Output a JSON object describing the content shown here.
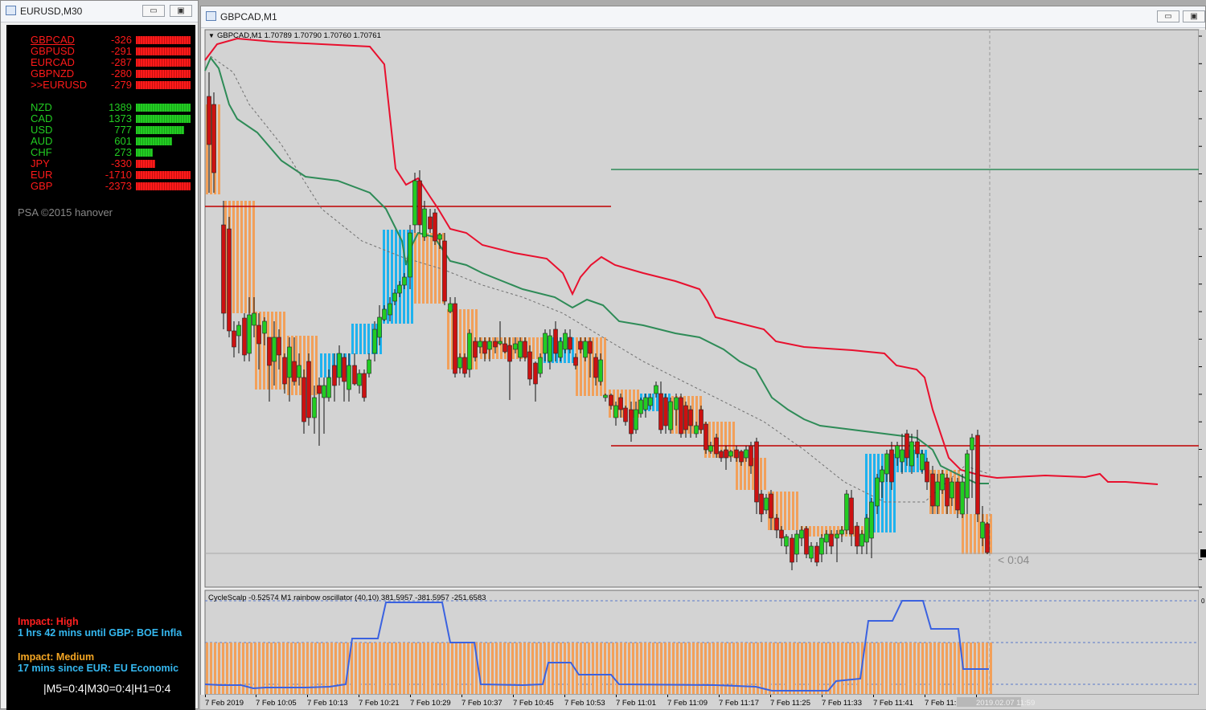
{
  "left_window": {
    "title": "EURUSD,M30",
    "pairs": [
      {
        "name": "GBPCAD",
        "value": "-326",
        "strength": 1.0,
        "underline": true
      },
      {
        "name": "GBPUSD",
        "value": "-291",
        "strength": 1.0
      },
      {
        "name": "EURCAD",
        "value": "-287",
        "strength": 1.0
      },
      {
        "name": "GBPNZD",
        "value": "-280",
        "strength": 1.0
      },
      {
        "name": ">>EURUSD",
        "value": "-279",
        "strength": 1.0
      }
    ],
    "currencies": [
      {
        "name": "NZD",
        "value": "1389",
        "strength": 1.0,
        "dir": "up"
      },
      {
        "name": "CAD",
        "value": "1373",
        "strength": 1.0,
        "dir": "up"
      },
      {
        "name": "USD",
        "value": "777",
        "strength": 0.88,
        "dir": "up"
      },
      {
        "name": "AUD",
        "value": "601",
        "strength": 0.66,
        "dir": "up"
      },
      {
        "name": "CHF",
        "value": "273",
        "strength": 0.31,
        "dir": "up"
      },
      {
        "name": "JPY",
        "value": "-330",
        "strength": 0.36,
        "dir": "down"
      },
      {
        "name": "EUR",
        "value": "-1710",
        "strength": 1.0,
        "dir": "down"
      },
      {
        "name": "GBP",
        "value": "-2373",
        "strength": 1.0,
        "dir": "down"
      }
    ],
    "copyright": "PSA ©2015 hanover",
    "news": {
      "high_label": "Impact: High",
      "high_text": "1 hrs 42 mins until GBP: BOE Infla",
      "medium_label": "Impact: Medium",
      "medium_text": "17 mins since EUR: EU Economic",
      "timeframes": "|M5=0:4|M30=0:4|H1=0:4"
    }
  },
  "right_window": {
    "title": "GBPCAD,M1",
    "chart_header": "GBPCAD,M1  1.70789 1.70790 1.70760 1.70761",
    "countdown": "< 0:04",
    "oscillator_header": "CycleScalp -0.52574  M1 rainbow oscillator (40,10) 381.5957 -381.5957 -251.6583",
    "time_labels": [
      "7 Feb 2019",
      "7 Feb 10:05",
      "7 Feb 10:13",
      "7 Feb 10:21",
      "7 Feb 10:29",
      "7 Feb 10:37",
      "7 Feb 10:45",
      "7 Feb 10:53",
      "7 Feb 11:01",
      "7 Feb 11:09",
      "7 Feb 11:17",
      "7 Feb 11:25",
      "7 Feb 11:33",
      "7 Feb 11:41",
      "7 Feb 11:",
      "2019.02.07 11:59"
    ]
  },
  "colors": {
    "bull": "#22cc22",
    "bear": "#cc1111",
    "orange": "#f2a05a",
    "blue": "#1fb2ee",
    "red_line": "#e8102e",
    "green_line": "#2e8b57",
    "osc_line": "#3b62e0",
    "hline_red": "#c00000"
  }
}
